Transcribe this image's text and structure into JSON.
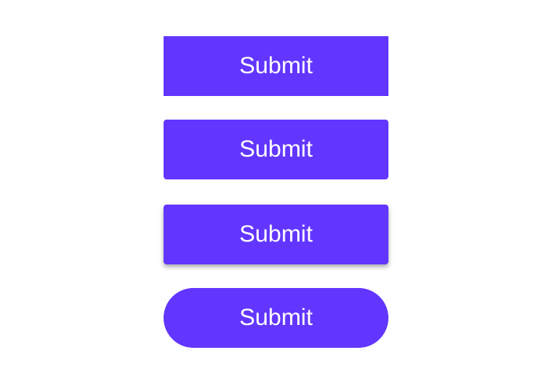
{
  "accent_color": "#6236FF",
  "buttons": [
    {
      "label": "Submit",
      "style": "square"
    },
    {
      "label": "Submit",
      "style": "rounded"
    },
    {
      "label": "Submit",
      "style": "rounded-shadow"
    },
    {
      "label": "Submit",
      "style": "pill"
    }
  ]
}
